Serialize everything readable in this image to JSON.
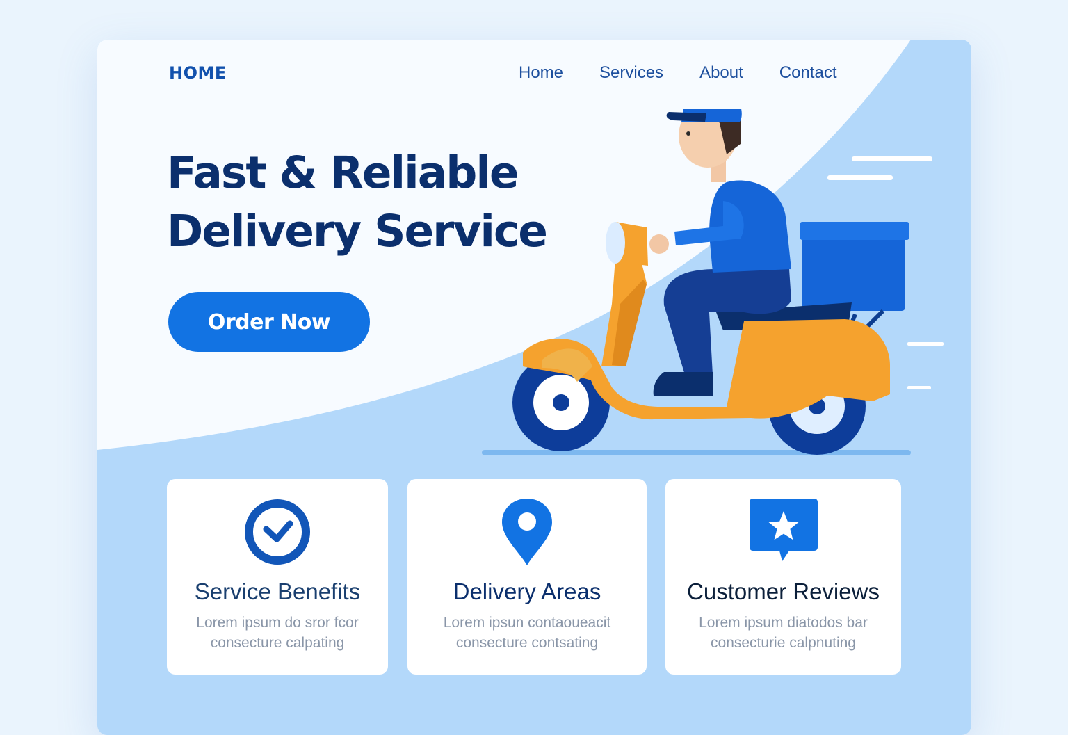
{
  "header": {
    "logo": "HOME",
    "nav": [
      "Home",
      "Services",
      "About",
      "Contact"
    ]
  },
  "hero": {
    "title_lines": [
      "Fast & Reliable",
      "Delivery Service"
    ],
    "cta_label": "Order Now"
  },
  "cards": [
    {
      "title": "Service Benefits",
      "text_lines": [
        "Lorem ipsum do sror fcor",
        "consecture calpating"
      ],
      "icon": "clock-icon"
    },
    {
      "title": "Delivery Areas",
      "text_lines": [
        "Lorem ipsun contaoueacit",
        "consecture contsating"
      ],
      "icon": "location-pin-icon"
    },
    {
      "title": "Customer Reviews",
      "text_lines": [
        "Lorem ipsum diatodos bar",
        "consecturie calpnuting"
      ],
      "icon": "star-chat-icon"
    }
  ],
  "colors": {
    "primary": "#1273e3",
    "navy": "#0b2f6d",
    "nav_text": "#1d4f9e",
    "hero_bg": "#f7fbff",
    "section_bg": "#b3d8fa",
    "scooter": "#f5a22e"
  }
}
